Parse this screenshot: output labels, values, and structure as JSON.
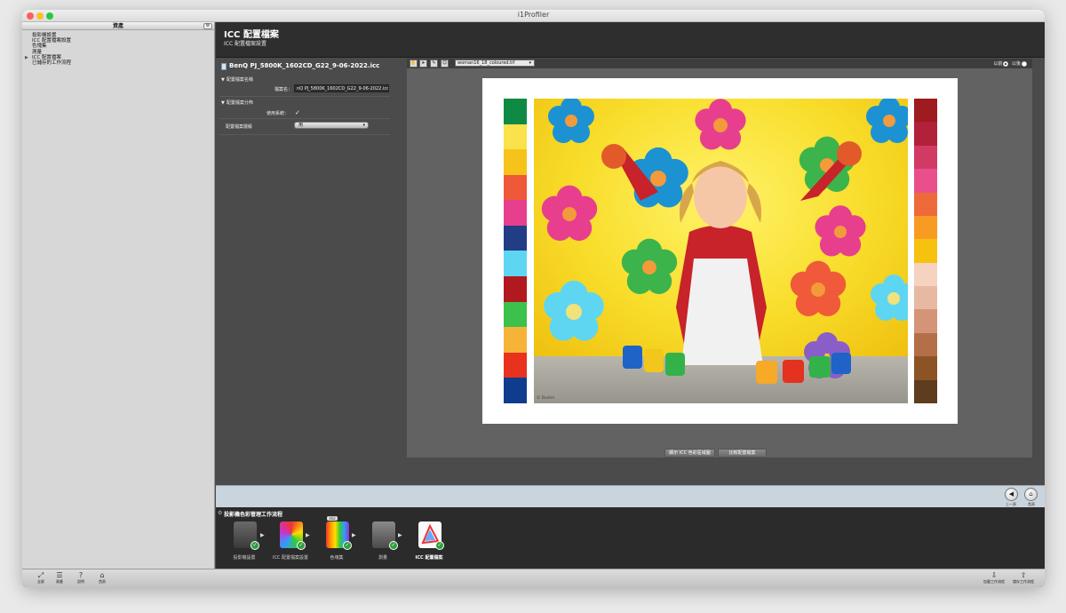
{
  "window": {
    "title": "i1Profiler"
  },
  "sidebar": {
    "header": "資產",
    "items": [
      {
        "label": "投影機設置",
        "current": false
      },
      {
        "label": "ICC 配置檔案設置",
        "current": false
      },
      {
        "label": "色塊集",
        "current": false
      },
      {
        "label": "測量",
        "current": false
      },
      {
        "label": "ICC 配置檔案",
        "current": true
      },
      {
        "label": "已儲存的工作流程",
        "current": false
      }
    ]
  },
  "header": {
    "title": "ICC 配置檔案",
    "subtitle": "ICC 配置檔案設置"
  },
  "profile": {
    "file_name": "BenQ PJ_5800K_1602CD_G22_9-06-2022.icc",
    "section_name": "配置檔案名稱",
    "file_label": "檔案名：",
    "file_value": "nQ PJ_5800K_1602CD_G22_9-06-2022.icc",
    "section_dist": "配置檔案分佈",
    "use_system_label": "使用系統：",
    "profile_level_label": "配置檔案層級",
    "profile_level_value": "用"
  },
  "preview": {
    "image_select": "woman16_18_coloured.tif",
    "radio_before": "以前",
    "radio_after": "以後",
    "credit": "© Bodim",
    "btn_gamut": "顯示 ICC 色彩區域圖",
    "btn_save": "比較配置檔案"
  },
  "nav": {
    "back_label": "上一頁",
    "home_label": "首頁"
  },
  "workflow": {
    "title": "投影機色彩管理工作流程",
    "steps": [
      {
        "label": "投影機設置"
      },
      {
        "label": "ICC 配置檔案設置"
      },
      {
        "label": "色塊集"
      },
      {
        "label": "測量"
      },
      {
        "label": "ICC 配置檔案"
      }
    ],
    "patch_badge": "162"
  },
  "bottombar": {
    "items": [
      {
        "label": "全屏"
      },
      {
        "label": "資產"
      },
      {
        "label": "說明"
      },
      {
        "label": "首頁"
      }
    ],
    "right": [
      {
        "label": "加載工作流程"
      },
      {
        "label": "儲存工作流程"
      }
    ]
  },
  "colors": {
    "left_strip": [
      "#0e8a45",
      "#f9e24b",
      "#f6c31b",
      "#f0583a",
      "#e73f8e",
      "#223d86",
      "#5ed6f2",
      "#b21820",
      "#3cc24c",
      "#f7b338",
      "#e8321d",
      "#103c8e"
    ],
    "right_strip": [
      "#9e1b1f",
      "#b3203a",
      "#d13a64",
      "#ea4f8c",
      "#ee6a3a",
      "#f79b23",
      "#f7c10f",
      "#f6d2c1",
      "#e8b9a2",
      "#d49478",
      "#b46f49",
      "#8c5424",
      "#5d3d1d"
    ]
  }
}
